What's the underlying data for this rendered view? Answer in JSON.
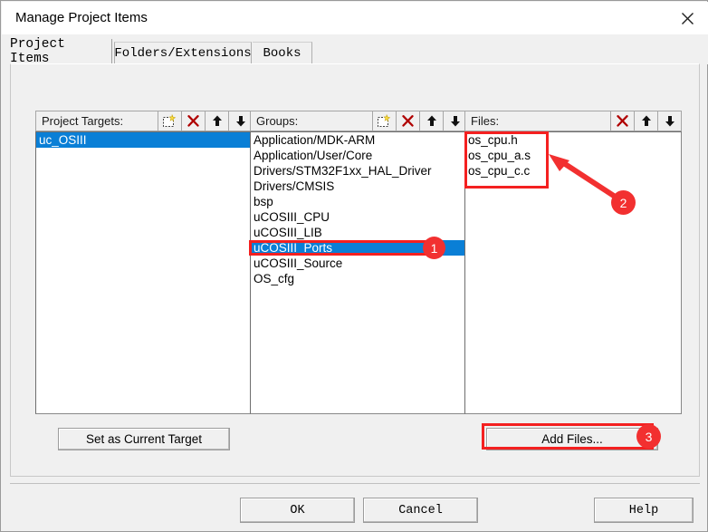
{
  "window": {
    "title": "Manage Project Items",
    "close_icon": "close-icon"
  },
  "tabs": [
    {
      "label": "Project Items",
      "active": true
    },
    {
      "label": "Folders/Extensions",
      "active": false
    },
    {
      "label": "Books",
      "active": false
    }
  ],
  "columns": {
    "targets": {
      "label": "Project Targets:",
      "icons": [
        "new-item-icon",
        "delete-icon",
        "move-up-icon",
        "move-down-icon"
      ],
      "items": [
        {
          "label": "uc_OSIII",
          "selected": true
        }
      ]
    },
    "groups": {
      "label": "Groups:",
      "icons": [
        "new-item-icon",
        "delete-icon",
        "move-up-icon",
        "move-down-icon"
      ],
      "items": [
        {
          "label": "Application/MDK-ARM",
          "selected": false
        },
        {
          "label": "Application/User/Core",
          "selected": false
        },
        {
          "label": "Drivers/STM32F1xx_HAL_Driver",
          "selected": false
        },
        {
          "label": "Drivers/CMSIS",
          "selected": false
        },
        {
          "label": "bsp",
          "selected": false
        },
        {
          "label": "uCOSIII_CPU",
          "selected": false
        },
        {
          "label": "uCOSIII_LIB",
          "selected": false
        },
        {
          "label": "uCOSIII_Ports",
          "selected": true
        },
        {
          "label": "uCOSIII_Source",
          "selected": false
        },
        {
          "label": "OS_cfg",
          "selected": false
        }
      ]
    },
    "files": {
      "label": "Files:",
      "icons": [
        "delete-icon",
        "move-up-icon",
        "move-down-icon"
      ],
      "items": [
        {
          "label": "os_cpu.h",
          "selected": false
        },
        {
          "label": "os_cpu_a.s",
          "selected": false
        },
        {
          "label": "os_cpu_c.c",
          "selected": false
        }
      ]
    }
  },
  "buttons": {
    "set_current_target": "Set as Current Target",
    "add_files": "Add Files...",
    "ok": "OK",
    "cancel": "Cancel",
    "help": "Help"
  },
  "annotations": {
    "accent_color": "#f23030",
    "badges": [
      {
        "number": "1",
        "target": "groups-selected-item"
      },
      {
        "number": "2",
        "target": "files-list"
      },
      {
        "number": "3",
        "target": "add-files-button"
      }
    ]
  }
}
